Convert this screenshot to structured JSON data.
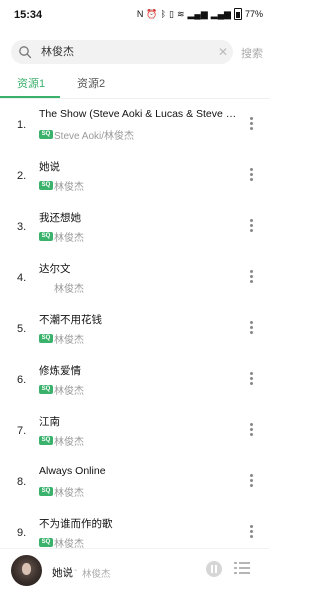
{
  "status_bar": {
    "time": "15:34",
    "icons": [
      "nfc-icon",
      "alarm-icon",
      "bluetooth-icon",
      "vibrate-icon",
      "wifi-icon",
      "signal-icon",
      "signal-icon",
      "battery-icon"
    ],
    "battery": "77%"
  },
  "search": {
    "query": "林俊杰",
    "button_label": "搜索"
  },
  "tabs": [
    {
      "label": "资源1",
      "active": true
    },
    {
      "label": "资源2",
      "active": false
    }
  ],
  "colors": {
    "accent": "#3bb26c"
  },
  "songs": [
    {
      "num": "1.",
      "title": "The Show (Steve Aoki & Lucas & Steve Re...",
      "artist": "Steve Aoki/林俊杰",
      "sq": true
    },
    {
      "num": "2.",
      "title": "她说",
      "artist": "林俊杰",
      "sq": true
    },
    {
      "num": "3.",
      "title": "我还想她",
      "artist": "林俊杰",
      "sq": true
    },
    {
      "num": "4.",
      "title": "达尔文",
      "artist": "林俊杰",
      "sq": false
    },
    {
      "num": "5.",
      "title": "不潮不用花钱",
      "artist": "林俊杰",
      "sq": true
    },
    {
      "num": "6.",
      "title": "修炼爱情",
      "artist": "林俊杰",
      "sq": true
    },
    {
      "num": "7.",
      "title": "江南",
      "artist": "林俊杰",
      "sq": true
    },
    {
      "num": "8.",
      "title": "Always Online",
      "artist": "林俊杰",
      "sq": true
    },
    {
      "num": "9.",
      "title": "不为谁而作的歌",
      "artist": "林俊杰",
      "sq": true
    }
  ],
  "badge_label": "SQ",
  "player": {
    "title": "她说",
    "separator": "-",
    "artist": "林俊杰"
  }
}
